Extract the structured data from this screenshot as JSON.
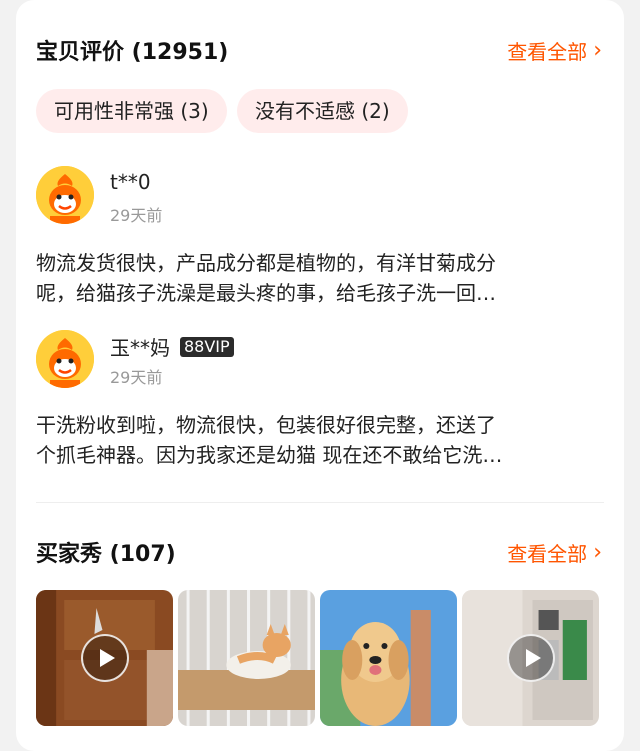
{
  "reviews_section": {
    "title": "宝贝评价 (12951)",
    "more_label": "查看全部",
    "tags": [
      "可用性非常强 (3)",
      "没有不适感 (2)"
    ],
    "items": [
      {
        "user": "t**0",
        "badge": "",
        "date": "29天前",
        "line1": "物流发货很快，产品成分都是植物的，有洋甘菊成分",
        "line2": "呢，给猫孩子洗澡是最头疼的事，给毛孩子洗一回…"
      },
      {
        "user": "玉**妈",
        "badge": "88VIP",
        "date": "29天前",
        "line1": "干洗粉收到啦，物流很快，包装很好很完整，还送了",
        "line2": "个抓毛神器。因为我家还是幼猫 现在还不敢给它洗…"
      }
    ]
  },
  "buyer_show": {
    "title": "买家秀 (107)",
    "more_label": "查看全部",
    "photos": [
      {
        "name": "video-door",
        "is_video": true
      },
      {
        "name": "photo-kitten-cage",
        "is_video": false
      },
      {
        "name": "photo-golden-retriever",
        "is_video": false
      },
      {
        "name": "video-product-box",
        "is_video": true
      }
    ]
  },
  "colors": {
    "accent": "#ff5500",
    "tag_bg": "#ffecec",
    "avatar_bg": "#ffce3a"
  }
}
